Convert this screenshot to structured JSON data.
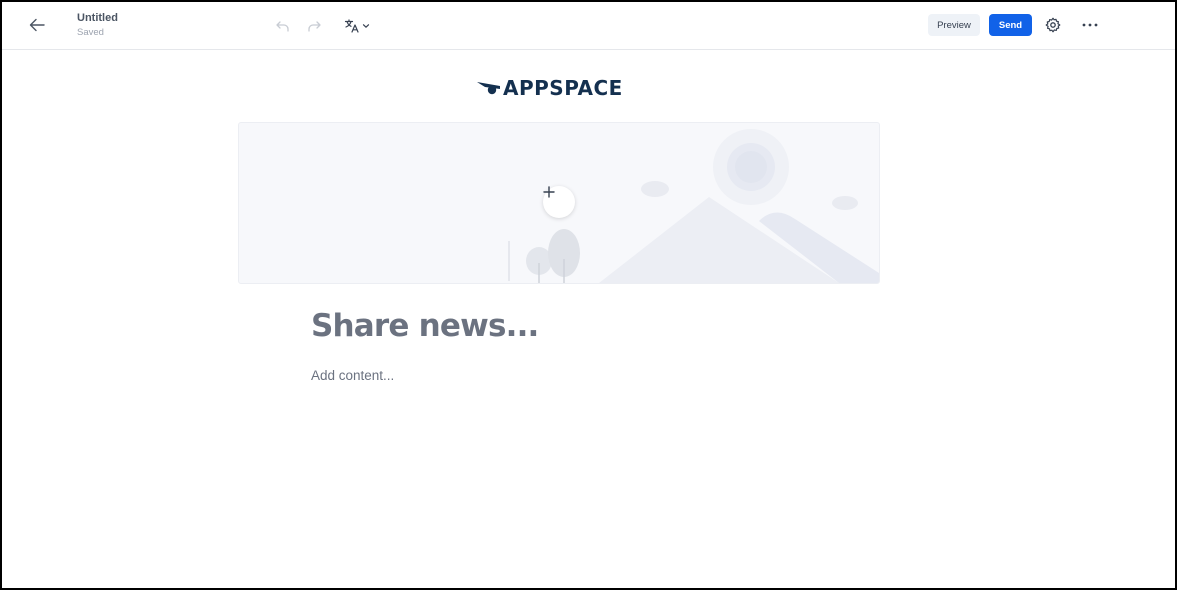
{
  "header": {
    "title": "Untitled",
    "status": "Saved",
    "icons": {
      "back": "arrow-left-icon",
      "undo": "undo-icon",
      "redo": "redo-icon",
      "translate": "translate-icon",
      "settings": "gear-icon",
      "more": "more-horizontal-icon"
    },
    "preview_label": "Preview",
    "send_label": "Send"
  },
  "logo": {
    "text": "APPSPACE",
    "color": "#14304f"
  },
  "hero": {
    "add_icon": "plus-icon"
  },
  "editor": {
    "headline_placeholder": "Share news...",
    "content_placeholder": "Add content..."
  },
  "colors": {
    "accent": "#1162e8",
    "placeholder_text": "#6b7280",
    "preview_bg": "#eef2f7"
  }
}
